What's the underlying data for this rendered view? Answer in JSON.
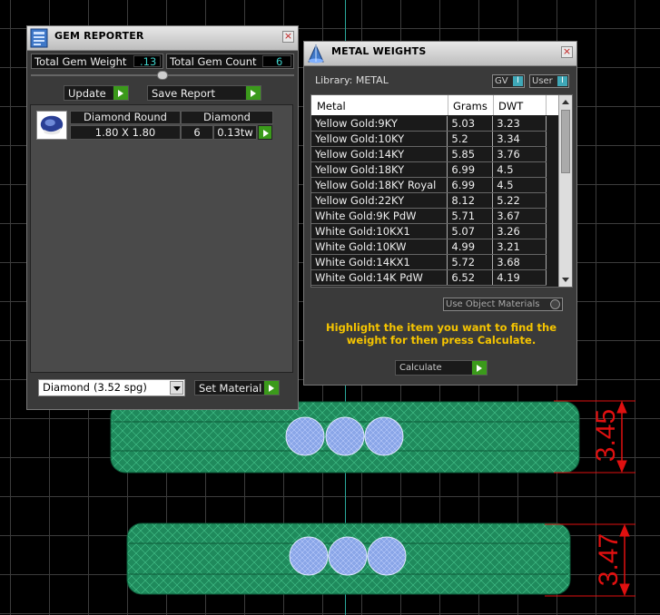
{
  "viewport": {
    "dim_top": "3.45",
    "dim_bottom": "3.47"
  },
  "gem_reporter": {
    "title": "GEM REPORTER",
    "close": "×",
    "total_gem_weight_label": "Total Gem Weight",
    "total_gem_weight": ".13",
    "total_gem_count_label": "Total Gem Count",
    "total_gem_count": "6",
    "update_label": "Update",
    "save_report_label": "Save Report",
    "gem_row": {
      "shape": "Diamond Round",
      "material": "Diamond",
      "size": "1.80 X 1.80",
      "count": "6",
      "weight": "0.13tw"
    },
    "material_select": {
      "value": "Diamond",
      "spg": "(3.52 spg)"
    },
    "set_material_label": "Set Material"
  },
  "metal_weights": {
    "title": "METAL WEIGHTS",
    "close": "×",
    "library_label": "Library: METAL",
    "gv_label": "GV",
    "user_label": "User",
    "toggle_mark": "I",
    "columns": {
      "metal": "Metal",
      "grams": "Grams",
      "dwt": "DWT"
    },
    "rows": [
      {
        "metal": "Yellow Gold:9KY",
        "grams": "5.03",
        "dwt": "3.23"
      },
      {
        "metal": "Yellow Gold:10KY",
        "grams": "5.2",
        "dwt": "3.34"
      },
      {
        "metal": "Yellow Gold:14KY",
        "grams": "5.85",
        "dwt": "3.76"
      },
      {
        "metal": "Yellow Gold:18KY",
        "grams": "6.99",
        "dwt": "4.5"
      },
      {
        "metal": "Yellow Gold:18KY Royal",
        "grams": "6.99",
        "dwt": "4.5"
      },
      {
        "metal": "Yellow Gold:22KY",
        "grams": "8.12",
        "dwt": "5.22"
      },
      {
        "metal": "White Gold:9K PdW",
        "grams": "5.71",
        "dwt": "3.67"
      },
      {
        "metal": "White Gold:10KX1",
        "grams": "5.07",
        "dwt": "3.26"
      },
      {
        "metal": "White Gold:10KW",
        "grams": "4.99",
        "dwt": "3.21"
      },
      {
        "metal": "White Gold:14KX1",
        "grams": "5.72",
        "dwt": "3.68"
      },
      {
        "metal": "White Gold:14K PdW",
        "grams": "6.52",
        "dwt": "4.19"
      }
    ],
    "use_object_materials_label": "Use Object Materials",
    "instruction": "Highlight the item you want to find the weight for then press Calculate.",
    "calculate_label": "Calculate"
  },
  "colors": {
    "accent_go": "#3b9a1b",
    "instruction_text": "#f5c400",
    "dimension_red": "#e01010",
    "ring_green": "#1f8a5c",
    "gem_blue": "#8aa6e8"
  }
}
